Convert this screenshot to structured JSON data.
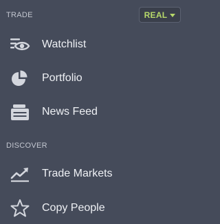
{
  "trade_section": {
    "header": "TRADE",
    "account_badge": {
      "label": "REAL",
      "color": "#b7d96a"
    },
    "items": [
      {
        "label": "Watchlist",
        "icon": "watchlist-eye-icon"
      },
      {
        "label": "Portfolio",
        "icon": "pie-chart-icon"
      },
      {
        "label": "News Feed",
        "icon": "news-feed-icon"
      }
    ]
  },
  "discover_section": {
    "header": "DISCOVER",
    "items": [
      {
        "label": "Trade Markets",
        "icon": "trend-chart-icon"
      },
      {
        "label": "Copy People",
        "icon": "star-icon"
      }
    ]
  },
  "colors": {
    "background": "#454b5a",
    "text": "#eef0f4",
    "header_text": "#c3c7d0",
    "icon": "#d4d7de"
  }
}
